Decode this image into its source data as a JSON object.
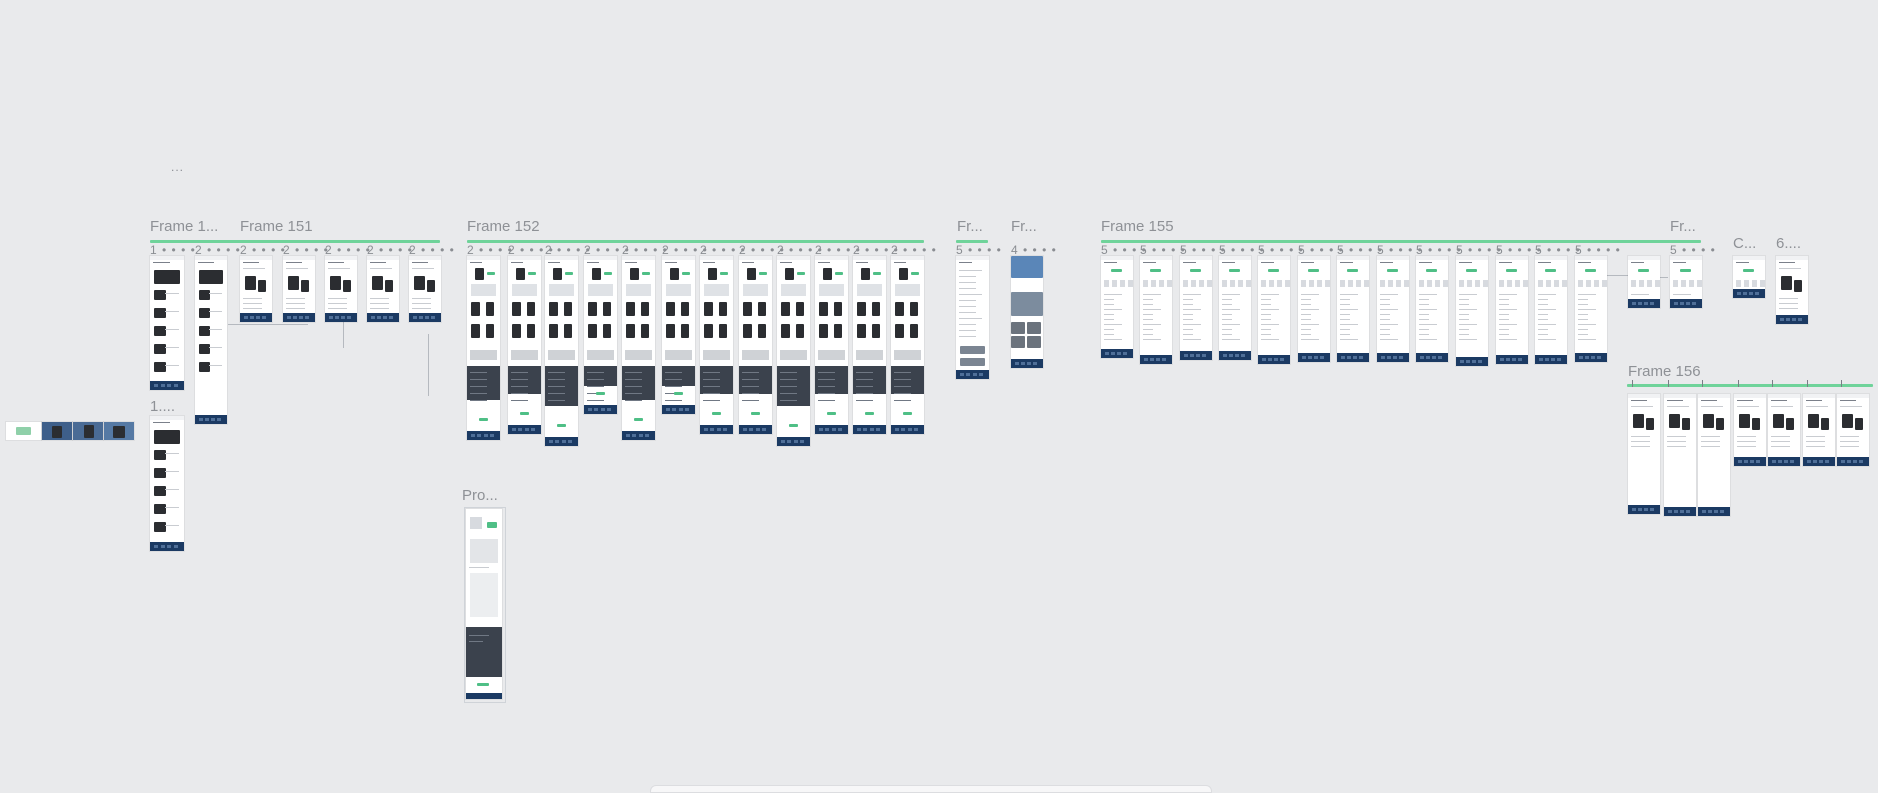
{
  "canvas": {
    "background": "#e9eaec",
    "top_marker": "..."
  },
  "frames": {
    "f150": {
      "title": "Frame 1...",
      "child_title": "1...."
    },
    "f151": {
      "title": "Frame 151"
    },
    "f152": {
      "title": "Frame 152",
      "sub_title": "Pro..."
    },
    "f153": {
      "title": "Fr..."
    },
    "f154": {
      "title": "Fr..."
    },
    "f155": {
      "title": "Frame 155"
    },
    "f_small": {
      "title": "Fr..."
    },
    "f_c": {
      "title": "C..."
    },
    "f_6": {
      "title": "6...."
    },
    "f156": {
      "title": "Frame 156"
    }
  },
  "child_labels": {
    "frame150": [
      "1",
      "2"
    ],
    "frame151": [
      "2",
      "2",
      "2",
      "2",
      "2"
    ],
    "frame152": [
      "2",
      "2",
      "2",
      "2",
      "2",
      "2",
      "2",
      "2",
      "2",
      "2",
      "2",
      "2"
    ],
    "frame153": [
      "5"
    ],
    "frame154": [
      "4"
    ],
    "frame155": [
      "5",
      "5",
      "5",
      "5",
      "5",
      "5",
      "5",
      "5",
      "5",
      "5",
      "5",
      "5",
      "5"
    ],
    "frame_small": [
      "5"
    ]
  },
  "colors": {
    "accent_green": "#6fd39a",
    "footer_navy": "#1b3a63",
    "dark_section": "#3b424d",
    "label_gray": "#8e9196"
  }
}
